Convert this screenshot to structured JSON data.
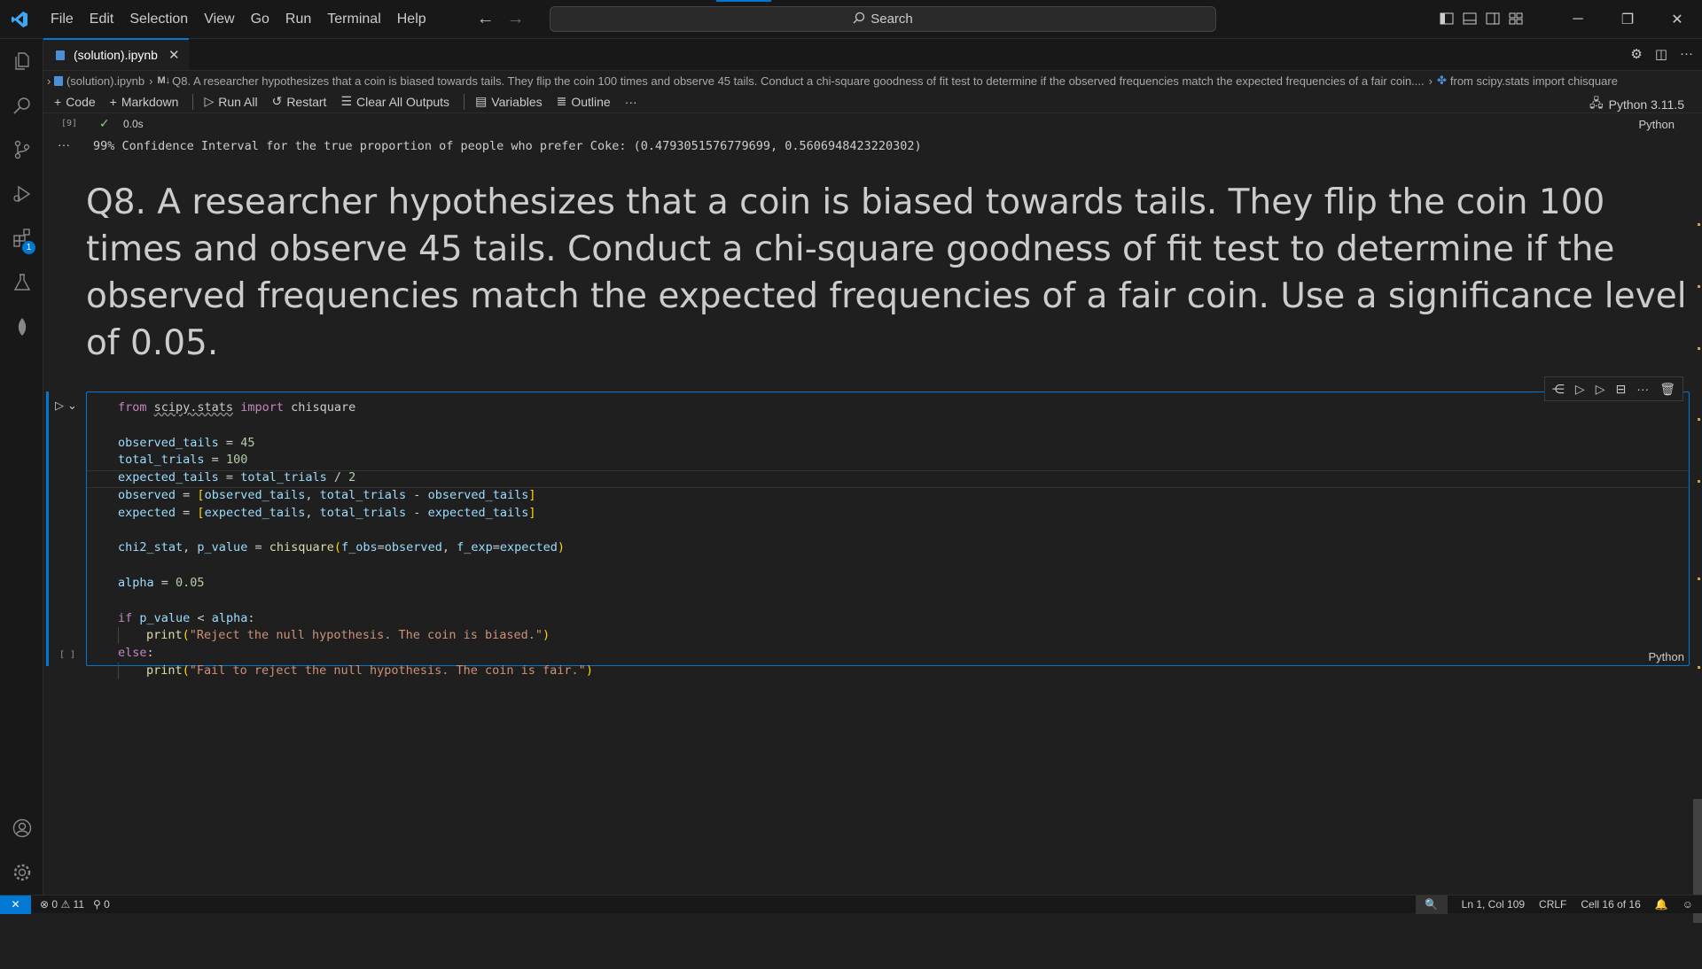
{
  "menu": [
    "File",
    "Edit",
    "Selection",
    "View",
    "Go",
    "Run",
    "Terminal",
    "Help"
  ],
  "search": {
    "label": "Search"
  },
  "tab": {
    "title": "(solution).ipynb"
  },
  "breadcrumb": {
    "file": "(solution).ipynb",
    "md_badge": "M↓",
    "section": "Q8. A researcher hypothesizes that a coin is biased towards tails. They flip the coin 100 times and observe 45 tails. Conduct a chi-square goodness of fit test to determine if the observed frequencies match the expected frequencies of a fair coin....",
    "symbol": "from scipy.stats import chisquare"
  },
  "toolbar": {
    "code": "Code",
    "markdown": "Markdown",
    "run_all": "Run All",
    "restart": "Restart",
    "clear_outputs": "Clear All Outputs",
    "variables": "Variables",
    "outline": "Outline",
    "more": "···"
  },
  "kernel": "Python 3.11.5",
  "prev_cell": {
    "exec_count": "[9]",
    "duration": "0.0s",
    "lang": "Python",
    "output": "99% Confidence Interval for the true proportion of people who prefer Coke: (0.4793051576779699, 0.5606948423220302)"
  },
  "markdown_cell": {
    "text": "Q8. A researcher hypothesizes that a coin is biased towards tails. They flip the coin 100 times and observe 45 tails. Conduct a chi-square goodness of fit test to determine if the observed frequencies match the expected frequencies of a fair coin. Use a significance level of 0.05."
  },
  "code_cell": {
    "exec_count": "[ ]",
    "lang": "Python"
  },
  "status": {
    "errors": "0",
    "warnings": "11",
    "ports": "0",
    "position": "Ln 1, Col 109",
    "eol": "CRLF",
    "cell": "Cell 16 of 16"
  },
  "colors": {
    "accent": "#0078d4",
    "background": "#1f1f1f"
  }
}
